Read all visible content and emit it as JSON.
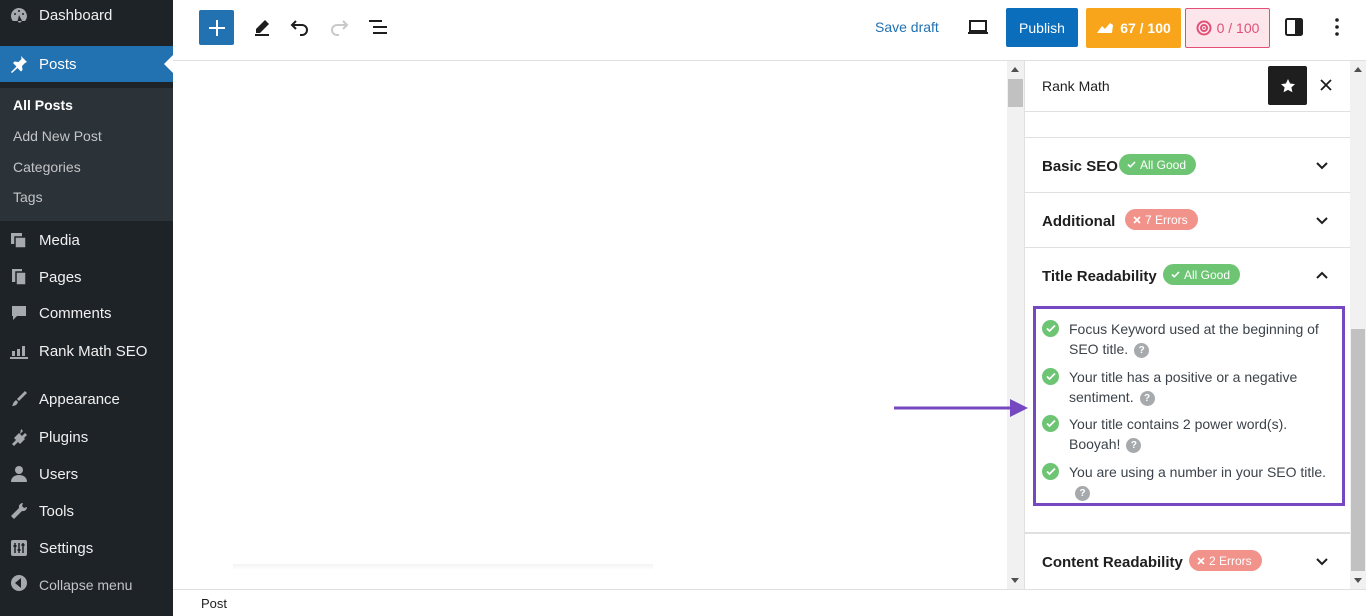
{
  "admin_menu": {
    "items": [
      {
        "key": "dashboard",
        "label": "Dashboard",
        "icon": "dashboard-icon"
      },
      {
        "key": "posts",
        "label": "Posts",
        "icon": "pushpin-icon"
      },
      {
        "key": "media",
        "label": "Media",
        "icon": "media-icon"
      },
      {
        "key": "pages",
        "label": "Pages",
        "icon": "pages-icon"
      },
      {
        "key": "comments",
        "label": "Comments",
        "icon": "comment-icon"
      },
      {
        "key": "rankmath",
        "label": "Rank Math SEO",
        "icon": "rank-math-icon"
      },
      {
        "key": "appearance",
        "label": "Appearance",
        "icon": "paintbrush-icon"
      },
      {
        "key": "plugins",
        "label": "Plugins",
        "icon": "plugin-icon"
      },
      {
        "key": "users",
        "label": "Users",
        "icon": "user-icon"
      },
      {
        "key": "tools",
        "label": "Tools",
        "icon": "wrench-icon"
      },
      {
        "key": "settings",
        "label": "Settings",
        "icon": "settings-icon"
      }
    ],
    "submenu": [
      "All Posts",
      "Add New Post",
      "Categories",
      "Tags"
    ],
    "collapse_label": "Collapse menu"
  },
  "toolbar": {
    "save_draft": "Save draft",
    "publish": "Publish",
    "seo_score": "67 / 100",
    "content_score": "0 / 100"
  },
  "panel": {
    "title": "Rank Math",
    "sections": [
      {
        "title": "Basic SEO",
        "badge": "All Good",
        "status": "good"
      },
      {
        "title": "Additional",
        "badge": "7 Errors",
        "status": "bad"
      },
      {
        "title": "Title Readability",
        "badge": "All Good",
        "status": "good"
      },
      {
        "title": "Content Readability",
        "badge": "2 Errors",
        "status": "bad"
      }
    ],
    "checks": [
      "Focus Keyword used at the beginning of SEO title.",
      "Your title has a positive or a negative sentiment.",
      "Your title contains 2 power word(s). Booyah!",
      "You are using a number in your SEO title."
    ],
    "help_glyph": "?"
  },
  "footer": {
    "breadcrumb": "Post"
  },
  "colors": {
    "admin_bg": "#1d2327",
    "active": "#2271b1",
    "good": "#6dc573",
    "bad": "#f1938b",
    "seo_score": "#f8a51b",
    "highlight": "#7548c1"
  }
}
